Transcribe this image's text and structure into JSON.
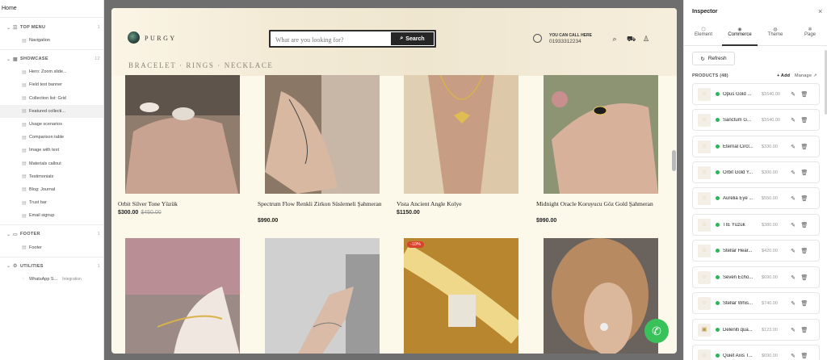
{
  "left": {
    "home": "Home",
    "sections": [
      {
        "name": "TOP MENU",
        "count": "1",
        "items": [
          {
            "label": "Navigation"
          }
        ]
      },
      {
        "name": "SHOWCASE",
        "count": "12",
        "items": [
          {
            "label": "Hero: Zoom slide..."
          },
          {
            "label": "Field test banner"
          },
          {
            "label": "Collection list: Grid"
          },
          {
            "label": "Featured collecti..."
          },
          {
            "label": "Usage scenarios"
          },
          {
            "label": "Comparison table"
          },
          {
            "label": "Image with text"
          },
          {
            "label": "Materials callout"
          },
          {
            "label": "Testimonials"
          },
          {
            "label": "Blog: Journal"
          },
          {
            "label": "Trust bar"
          },
          {
            "label": "Email signup"
          }
        ]
      },
      {
        "name": "FOOTER",
        "count": "1",
        "items": [
          {
            "label": "Footer"
          }
        ]
      },
      {
        "name": "UTILITIES",
        "count": "1",
        "items": [
          {
            "label": "WhatsApp S...",
            "tag": "Integration"
          }
        ]
      }
    ]
  },
  "store": {
    "brand": "PURGY",
    "search_placeholder": "What are you looking for?",
    "search_button": "Search",
    "call_label": "YOU CAN CALL HERE",
    "call_number": "01933312234",
    "nav": "BRACELET · RINGS · NECKLACE",
    "products": [
      {
        "name": "Orbit Silver Tone Yüzük",
        "price": "$300.00",
        "old_price": "$450.00"
      },
      {
        "name": "Spectrum Flow Renkli Zirkon Süslemeli Şahmeran",
        "price": "$990.00"
      },
      {
        "name": "Vista Ancient Angle Kolye",
        "price": "$1150.00"
      },
      {
        "name": "Midnight Oracle Koruyucu Göz Gold Şahmeran",
        "price": "$990.00"
      }
    ],
    "badge": "-10%"
  },
  "inspector": {
    "title": "Inspector",
    "tabs": [
      {
        "label": "Element",
        "icon": "cube-icon"
      },
      {
        "label": "Commerce",
        "icon": "cart-icon"
      },
      {
        "label": "Theme",
        "icon": "palette-icon"
      },
      {
        "label": "Page",
        "icon": "gear-icon"
      }
    ],
    "refresh": "Refresh",
    "products_header": "PRODUCTS (48)",
    "add": "+ Add",
    "manage": "Manage",
    "products": [
      {
        "name": "Opus Gold ...",
        "price": "$1640.00"
      },
      {
        "name": "Sanctum G...",
        "price": "$1640.00"
      },
      {
        "name": "Eternal Circl...",
        "price": "$330.00"
      },
      {
        "name": "Orbit Gold Y...",
        "price": "$300.00"
      },
      {
        "name": "Aurelia Eye ...",
        "price": "$550.00"
      },
      {
        "name": "TIE Yüzük",
        "price": "$380.00"
      },
      {
        "name": "Stellar Hear...",
        "price": "$420.00"
      },
      {
        "name": "Seven Echo...",
        "price": "$690.00"
      },
      {
        "name": "Stellar Whis...",
        "price": "$740.00"
      },
      {
        "name": "Deleniti qua...",
        "price": "$123.00"
      },
      {
        "name": "Quiet Axis T...",
        "price": "$690.00"
      }
    ]
  },
  "colors": {
    "accent": "#2c2c2c",
    "whatsapp": "#3ac25a",
    "badge": "#d8432f",
    "status": "#2fb45a"
  }
}
